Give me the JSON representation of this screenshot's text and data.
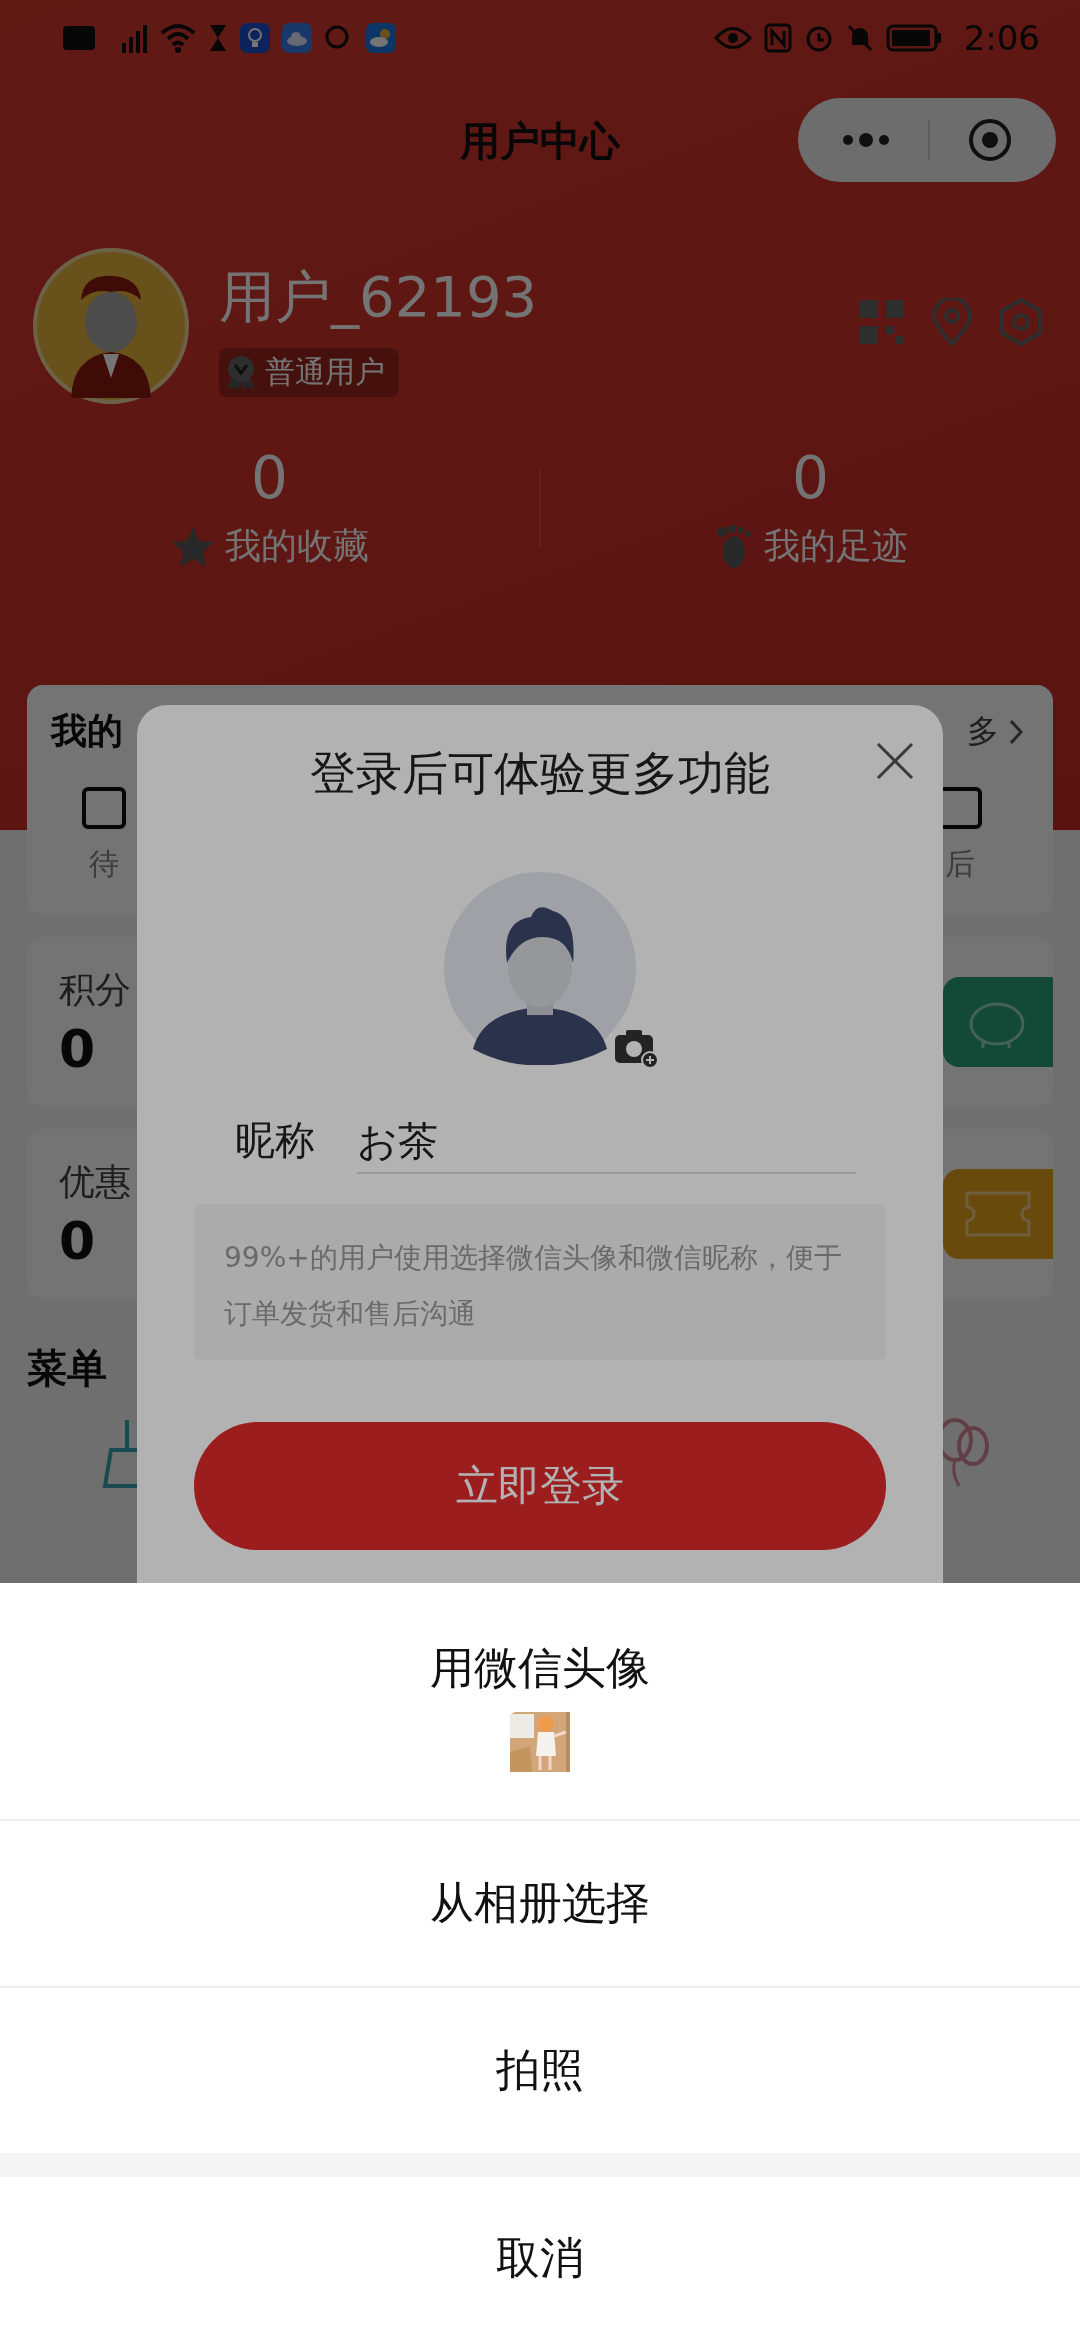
{
  "status_bar": {
    "time": "2:06"
  },
  "nav": {
    "title": "用户中心"
  },
  "profile": {
    "username": "用户_62193",
    "badge": "普通用户"
  },
  "stats": [
    {
      "value": "0",
      "label": "我的收藏",
      "kind": "star"
    },
    {
      "value": "0",
      "label": "我的足迹",
      "kind": "footprint"
    }
  ],
  "orders_card": {
    "title": "我的",
    "more": "多",
    "items": [
      "待",
      "后"
    ]
  },
  "assets": [
    {
      "label": "积分",
      "value": "0",
      "kind": "points"
    },
    {
      "label": "优惠",
      "value": "0",
      "kind": "coupon"
    }
  ],
  "menu_section": {
    "title": "菜单"
  },
  "login_dialog": {
    "title": "登录后可体验更多功能",
    "nickname_label": "昵称",
    "nickname_value": "お茶",
    "hint": "99%+的用户使用选择微信头像和微信昵称，便于订单发货和售后沟通",
    "button": "立即登录"
  },
  "action_sheet": {
    "options": [
      {
        "label": "用微信头像",
        "kind": "wechat"
      },
      {
        "label": "从相册选择",
        "kind": "plain"
      },
      {
        "label": "拍照",
        "kind": "plain"
      }
    ],
    "cancel": "取消"
  }
}
